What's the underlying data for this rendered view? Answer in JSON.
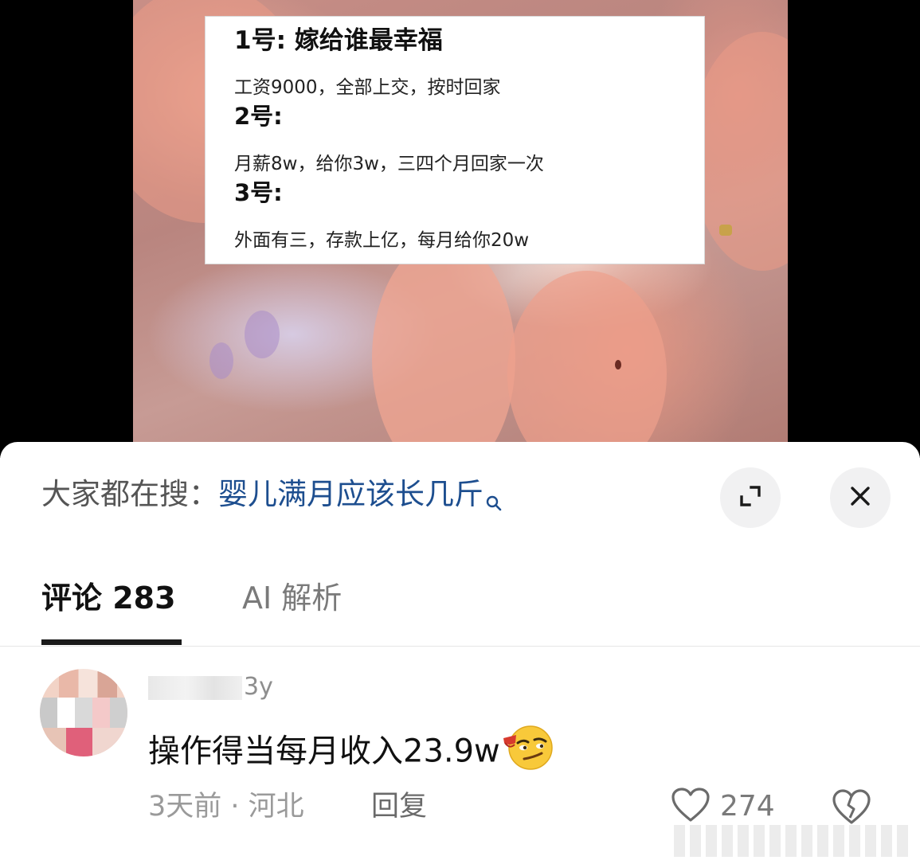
{
  "video": {
    "overlay": {
      "option1_title": "1号: 嫁给谁最幸福",
      "option1_desc": "工资9000，全部上交，按时回家",
      "option2_title": "2号:",
      "option2_desc": "月薪8w，给你3w，三四个月回家一次",
      "option3_title": "3号:",
      "option3_desc": "外面有三，存款上亿，每月给你20w"
    }
  },
  "sheet": {
    "search_label": "大家都在搜：",
    "search_query": "婴儿满月应该长几斤",
    "expand_icon": "expand-icon",
    "close_icon": "close-icon"
  },
  "tabs": {
    "comments_label": "评论 283",
    "ai_label": "AI 解析"
  },
  "comment": {
    "username_suffix": "3y",
    "text": "操作得当每月收入23.9w",
    "emoji": "smirk-emoji",
    "time_location": "3天前 · 河北",
    "reply_label": "回复",
    "like_count": "274"
  },
  "colors": {
    "link": "#1d4e8f",
    "tab_active": "#111111",
    "tab_inactive": "#7a7a7a",
    "meta": "#9a9a9a"
  }
}
